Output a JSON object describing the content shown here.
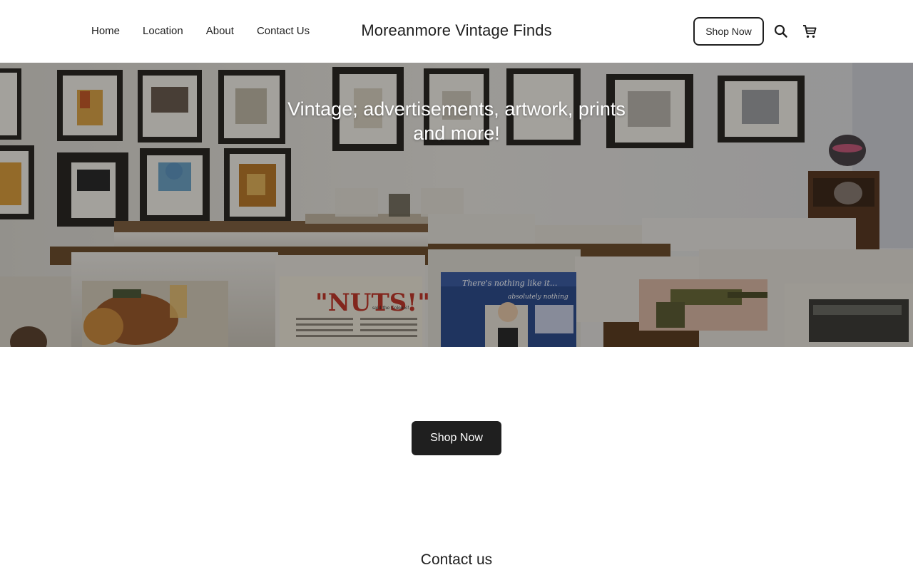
{
  "header": {
    "nav": [
      {
        "label": "Home"
      },
      {
        "label": "Location"
      },
      {
        "label": "About"
      },
      {
        "label": "Contact Us"
      }
    ],
    "brand": "Moreanmore Vintage Finds",
    "shop_button": "Shop Now",
    "icons": [
      "search-icon",
      "cart-icon"
    ]
  },
  "hero": {
    "title": "Vintage; advertisements, artwork, prints and more!",
    "image_subject": "store interior with framed vintage prints on walls and bins of vintage advertisements",
    "print_texts": {
      "nuts": "\"NUTS!\"",
      "nuts_sub": "said the Colonel!",
      "nothing": "There's nothing like it...",
      "nothing_sub": "absolutely nothing"
    }
  },
  "main": {
    "cta_label": "Shop Now",
    "contact_heading": "Contact us"
  },
  "colors": {
    "text": "#1f1f1f",
    "button_dark": "#1f1f1f",
    "background": "#ffffff"
  }
}
